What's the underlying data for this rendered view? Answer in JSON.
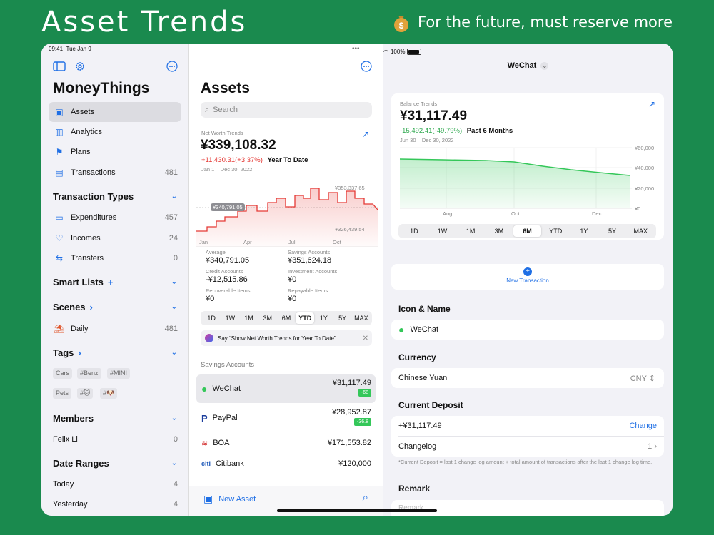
{
  "banner": {
    "title": "Asset Trends",
    "tagline": "For the future, must reserve more",
    "icon": "money-bag-icon"
  },
  "status": {
    "time": "09:41",
    "date": "Tue Jan 9",
    "battery": "100%"
  },
  "sidebar": {
    "title": "MoneyThings",
    "items": [
      {
        "label": "Assets",
        "count": "",
        "icon": "assets-icon"
      },
      {
        "label": "Analytics",
        "count": "",
        "icon": "analytics-icon"
      },
      {
        "label": "Plans",
        "count": "",
        "icon": "plans-icon"
      },
      {
        "label": "Transactions",
        "count": "481",
        "icon": "transactions-icon"
      }
    ],
    "transaction_types": {
      "heading": "Transaction Types",
      "items": [
        {
          "label": "Expenditures",
          "count": "457"
        },
        {
          "label": "Incomes",
          "count": "24"
        },
        {
          "label": "Transfers",
          "count": "0"
        }
      ]
    },
    "smart_lists": {
      "heading": "Smart Lists",
      "add": "+"
    },
    "scenes": {
      "heading": "Scenes",
      "items": [
        {
          "label": "Daily",
          "count": "481"
        }
      ]
    },
    "tags": {
      "heading": "Tags",
      "items": [
        "Cars",
        "#Benz",
        "#MINI",
        "Pets",
        "#🐱",
        "#🐶"
      ]
    },
    "members": {
      "heading": "Members",
      "items": [
        {
          "label": "Felix Li",
          "count": "0"
        }
      ]
    },
    "date_ranges": {
      "heading": "Date Ranges",
      "items": [
        {
          "label": "Today",
          "count": "4"
        },
        {
          "label": "Yesterday",
          "count": "4"
        }
      ]
    }
  },
  "assets": {
    "title": "Assets",
    "search_placeholder": "Search",
    "trend_label": "Net Worth Trends",
    "net_worth": "¥339,108.32",
    "change": "+11,430.31(+3.37%)",
    "change_period": "Year To Date",
    "date_range": "Jan 1 – Dec 30, 2022",
    "chart_high": "¥353,337.65",
    "chart_low": "¥326,439.54",
    "chart_marker": "¥340,791.05",
    "months": [
      "Jan",
      "Apr",
      "Jul",
      "Oct"
    ],
    "stats": [
      {
        "label": "Average",
        "value": "¥340,791.05"
      },
      {
        "label": "Savings Accounts",
        "value": "¥351,624.18"
      },
      {
        "label": "Credit Accounts",
        "value": "-¥12,515.86"
      },
      {
        "label": "Investment Accounts",
        "value": "¥0"
      },
      {
        "label": "Recoverable Items",
        "value": "¥0"
      },
      {
        "label": "Repayable Items",
        "value": "¥0"
      }
    ],
    "ranges": [
      "1D",
      "1W",
      "1M",
      "3M",
      "6M",
      "YTD",
      "1Y",
      "5Y",
      "MAX"
    ],
    "active_range": "YTD",
    "siri_tip": "Say “Show Net Worth Trends for Year To Date”",
    "section": "Savings Accounts",
    "accounts": [
      {
        "name": "WeChat",
        "amount": "¥31,117.49",
        "delta": "-68"
      },
      {
        "name": "PayPal",
        "amount": "¥28,952.87",
        "delta": "-36.8"
      },
      {
        "name": "BOA",
        "amount": "¥171,553.82",
        "delta": ""
      },
      {
        "name": "Citibank",
        "amount": "¥120,000",
        "delta": ""
      }
    ],
    "new_asset": "New Asset"
  },
  "detail": {
    "header": "WeChat",
    "trend_label": "Balance Trends",
    "balance": "¥31,117.49",
    "change": "-15,492.41(-49.79%)",
    "change_period": "Past 6 Months",
    "date_range": "Jun 30 – Dec 30, 2022",
    "y_ticks": [
      "¥60,000",
      "¥40,000",
      "¥20,000",
      "¥0"
    ],
    "months": [
      "Aug",
      "Oct",
      "Dec"
    ],
    "ranges": [
      "1D",
      "1W",
      "1M",
      "3M",
      "6M",
      "YTD",
      "1Y",
      "5Y",
      "MAX"
    ],
    "active_range": "6M",
    "new_transaction": "New Transaction",
    "icon_name_heading": "Icon & Name",
    "name": "WeChat",
    "currency_heading": "Currency",
    "currency": "Chinese Yuan",
    "currency_code": "CNY",
    "deposit_heading": "Current Deposit",
    "deposit": "+¥31,117.49",
    "change_action": "Change",
    "changelog": "Changelog",
    "changelog_count": "1",
    "footnote": "*Current Deposit = last 1 change log amount + total amount of transactions after the last 1 change log time.",
    "remark_heading": "Remark",
    "remark_placeholder": "Remark"
  },
  "colors": {
    "background": "#1a8a4e",
    "accent": "#1f6fe5",
    "positive": "#34c759",
    "negative": "#e53935"
  }
}
